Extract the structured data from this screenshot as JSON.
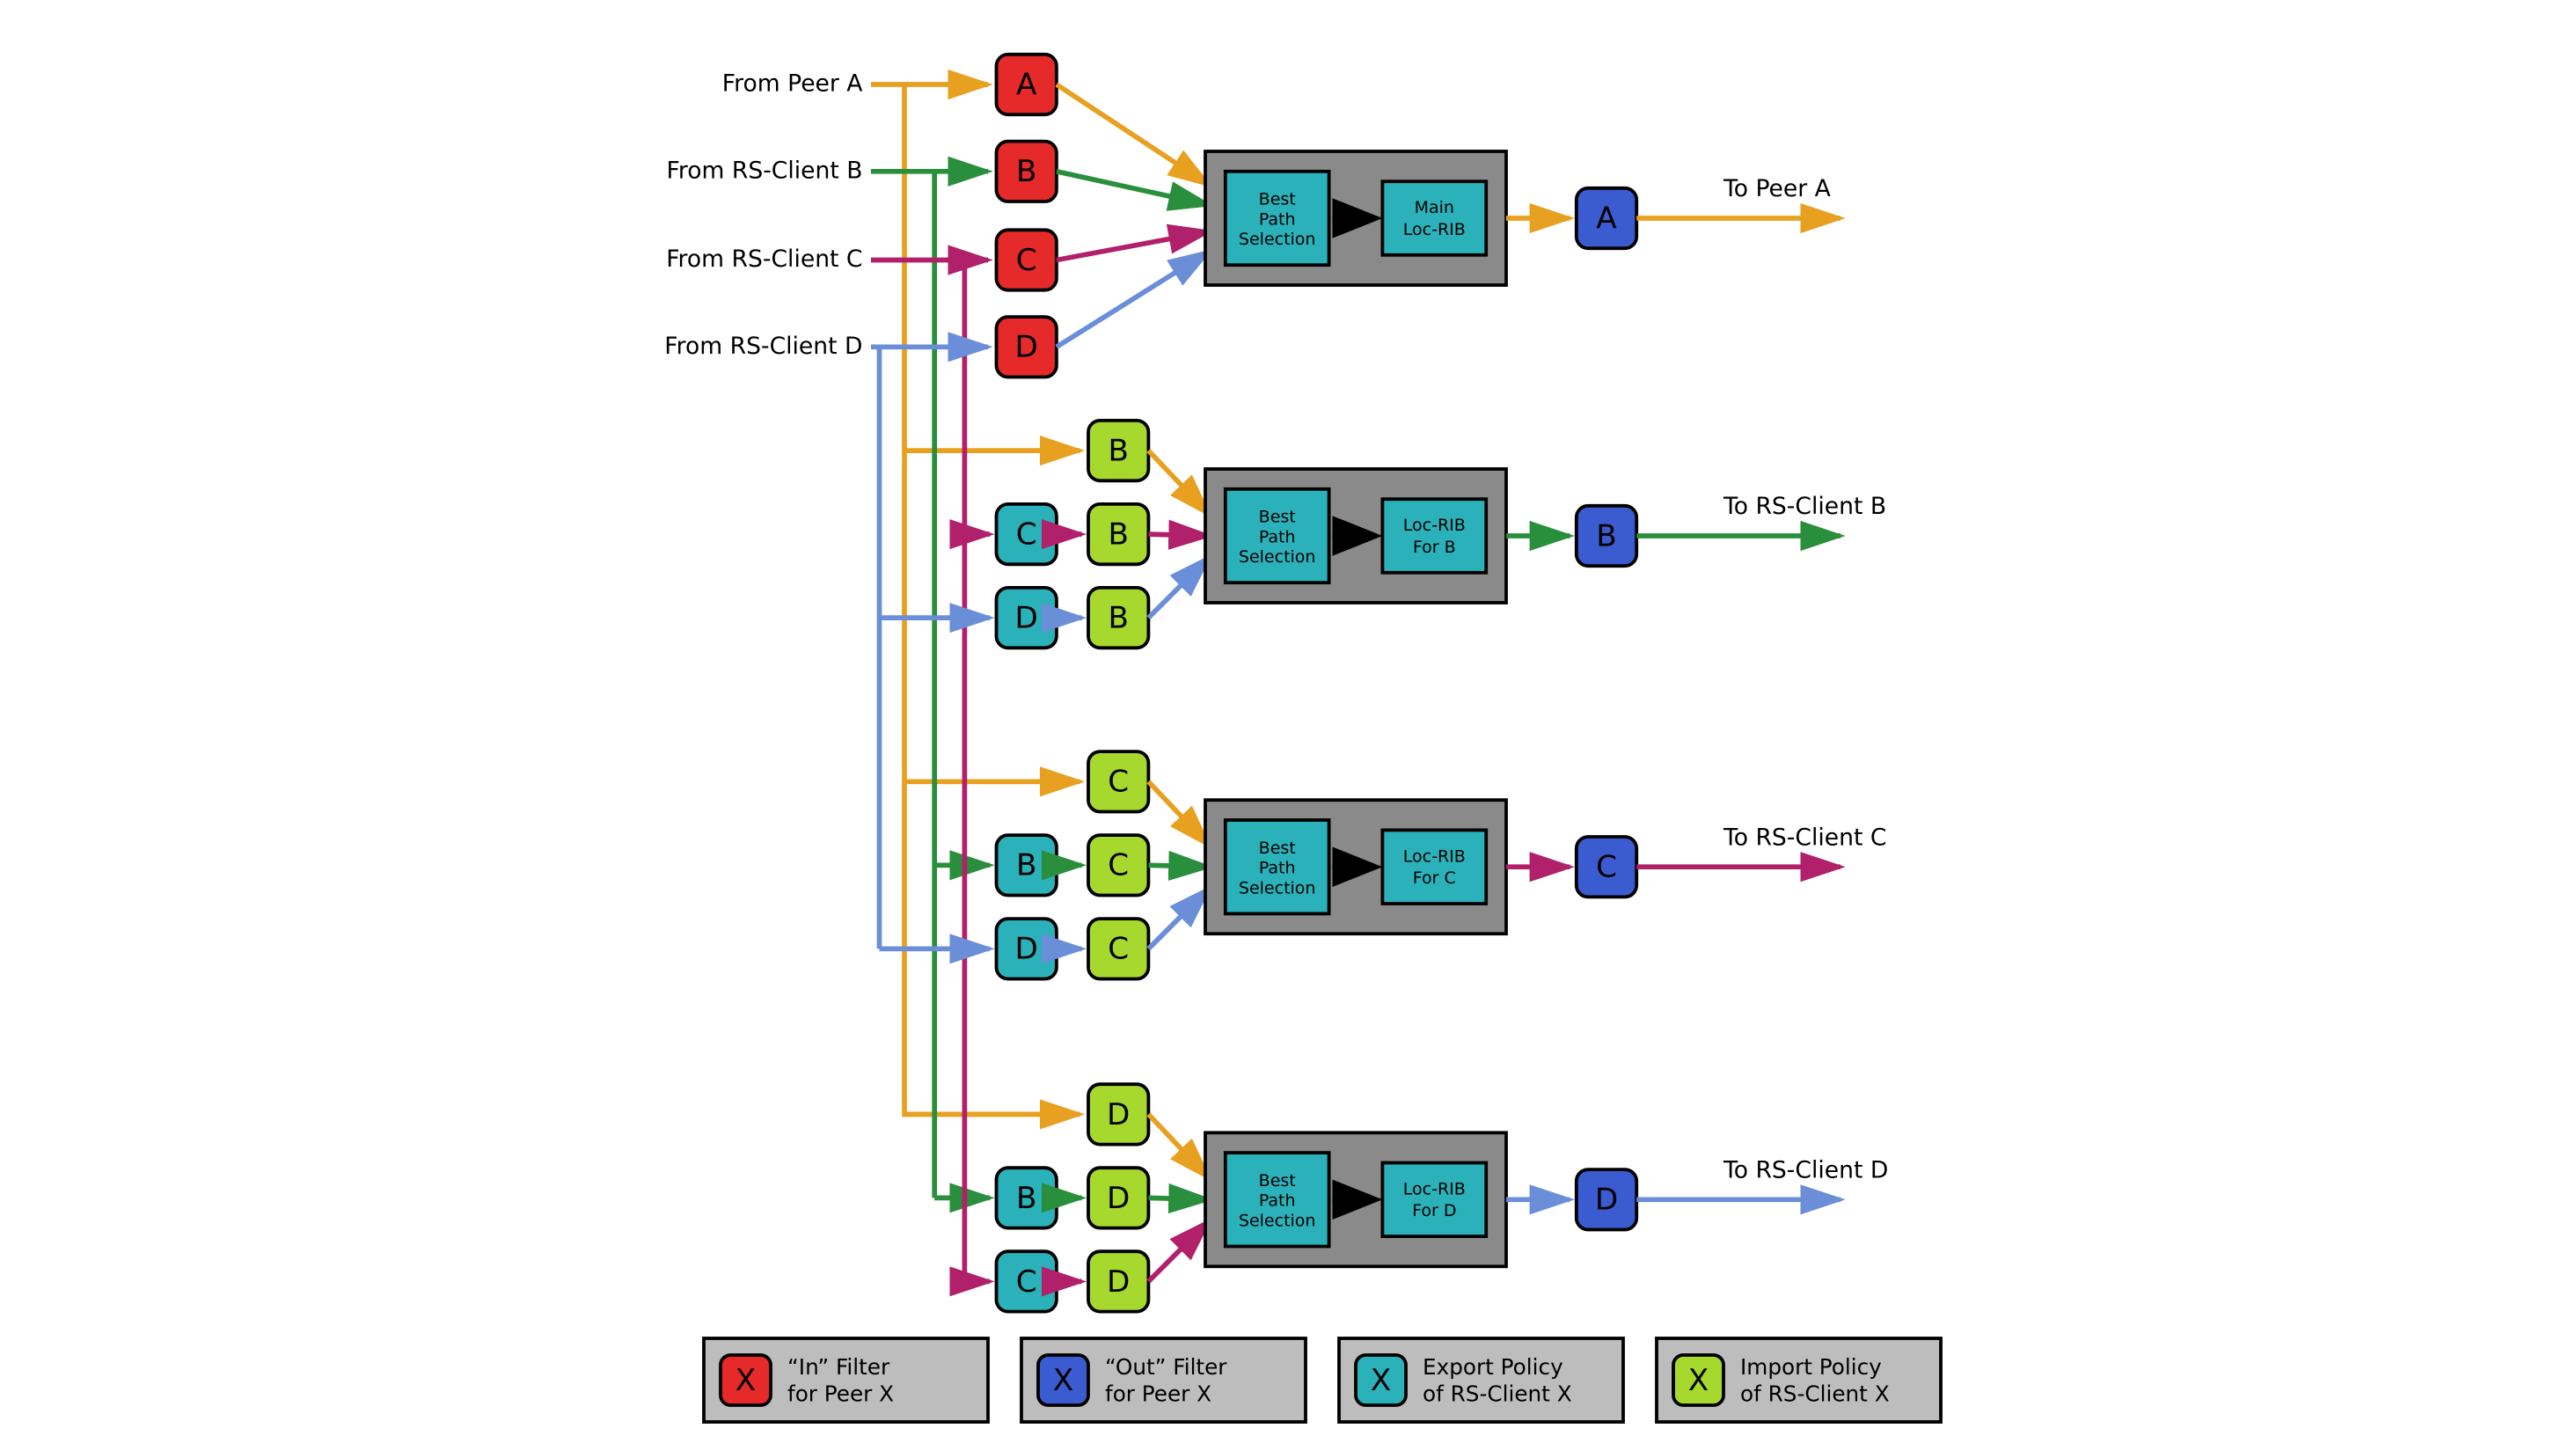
{
  "sourceLabels": {
    "A": "From Peer A",
    "B": "From RS-Client B",
    "C": "From RS-Client C",
    "D": "From RS-Client D"
  },
  "destLabels": {
    "A": "To Peer A",
    "B": "To RS-Client B",
    "C": "To RS-Client C",
    "D": "To RS-Client D"
  },
  "bpsLines": {
    "l1": "Best",
    "l2": "Path",
    "l3": "Selection"
  },
  "locRib": {
    "mainL1": "Main",
    "mainL2": "Loc-RIB",
    "forL1": "Loc-RIB",
    "forB": "For B",
    "forC": "For C",
    "forD": "For D"
  },
  "nodes": {
    "A": "A",
    "B": "B",
    "C": "C",
    "D": "D",
    "X": "X"
  },
  "legend": {
    "in": {
      "l1": "“In” Filter",
      "l2": "for Peer X"
    },
    "out": {
      "l1": "“Out” Filter",
      "l2": "for Peer X"
    },
    "exp": {
      "l1": "Export Policy",
      "l2": "of RS-Client X"
    },
    "imp": {
      "l1": "Import Policy",
      "l2": "of RS-Client X"
    }
  },
  "colors": {
    "orange": "#e8a020",
    "green": "#2a8f3c",
    "magenta": "#b1206a",
    "lblue": "#6a8ed8",
    "black": "#000000"
  }
}
